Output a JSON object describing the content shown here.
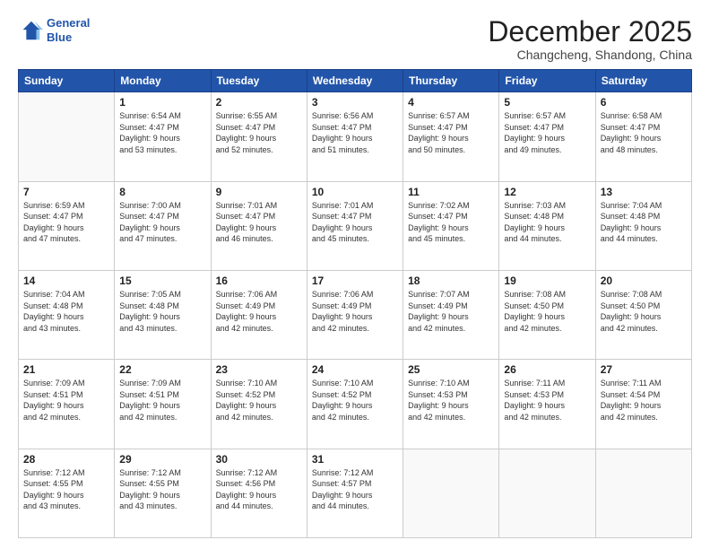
{
  "header": {
    "logo_line1": "General",
    "logo_line2": "Blue",
    "month": "December 2025",
    "location": "Changcheng, Shandong, China"
  },
  "days_of_week": [
    "Sunday",
    "Monday",
    "Tuesday",
    "Wednesday",
    "Thursday",
    "Friday",
    "Saturday"
  ],
  "weeks": [
    [
      {
        "day": "",
        "sunrise": "",
        "sunset": "",
        "daylight": ""
      },
      {
        "day": "1",
        "sunrise": "6:54 AM",
        "sunset": "4:47 PM",
        "daylight": "9 hours and 53 minutes."
      },
      {
        "day": "2",
        "sunrise": "6:55 AM",
        "sunset": "4:47 PM",
        "daylight": "9 hours and 52 minutes."
      },
      {
        "day": "3",
        "sunrise": "6:56 AM",
        "sunset": "4:47 PM",
        "daylight": "9 hours and 51 minutes."
      },
      {
        "day": "4",
        "sunrise": "6:57 AM",
        "sunset": "4:47 PM",
        "daylight": "9 hours and 50 minutes."
      },
      {
        "day": "5",
        "sunrise": "6:57 AM",
        "sunset": "4:47 PM",
        "daylight": "9 hours and 49 minutes."
      },
      {
        "day": "6",
        "sunrise": "6:58 AM",
        "sunset": "4:47 PM",
        "daylight": "9 hours and 48 minutes."
      }
    ],
    [
      {
        "day": "7",
        "sunrise": "6:59 AM",
        "sunset": "4:47 PM",
        "daylight": "9 hours and 47 minutes."
      },
      {
        "day": "8",
        "sunrise": "7:00 AM",
        "sunset": "4:47 PM",
        "daylight": "9 hours and 47 minutes."
      },
      {
        "day": "9",
        "sunrise": "7:01 AM",
        "sunset": "4:47 PM",
        "daylight": "9 hours and 46 minutes."
      },
      {
        "day": "10",
        "sunrise": "7:01 AM",
        "sunset": "4:47 PM",
        "daylight": "9 hours and 45 minutes."
      },
      {
        "day": "11",
        "sunrise": "7:02 AM",
        "sunset": "4:47 PM",
        "daylight": "9 hours and 45 minutes."
      },
      {
        "day": "12",
        "sunrise": "7:03 AM",
        "sunset": "4:48 PM",
        "daylight": "9 hours and 44 minutes."
      },
      {
        "day": "13",
        "sunrise": "7:04 AM",
        "sunset": "4:48 PM",
        "daylight": "9 hours and 44 minutes."
      }
    ],
    [
      {
        "day": "14",
        "sunrise": "7:04 AM",
        "sunset": "4:48 PM",
        "daylight": "9 hours and 43 minutes."
      },
      {
        "day": "15",
        "sunrise": "7:05 AM",
        "sunset": "4:48 PM",
        "daylight": "9 hours and 43 minutes."
      },
      {
        "day": "16",
        "sunrise": "7:06 AM",
        "sunset": "4:49 PM",
        "daylight": "9 hours and 42 minutes."
      },
      {
        "day": "17",
        "sunrise": "7:06 AM",
        "sunset": "4:49 PM",
        "daylight": "9 hours and 42 minutes."
      },
      {
        "day": "18",
        "sunrise": "7:07 AM",
        "sunset": "4:49 PM",
        "daylight": "9 hours and 42 minutes."
      },
      {
        "day": "19",
        "sunrise": "7:08 AM",
        "sunset": "4:50 PM",
        "daylight": "9 hours and 42 minutes."
      },
      {
        "day": "20",
        "sunrise": "7:08 AM",
        "sunset": "4:50 PM",
        "daylight": "9 hours and 42 minutes."
      }
    ],
    [
      {
        "day": "21",
        "sunrise": "7:09 AM",
        "sunset": "4:51 PM",
        "daylight": "9 hours and 42 minutes."
      },
      {
        "day": "22",
        "sunrise": "7:09 AM",
        "sunset": "4:51 PM",
        "daylight": "9 hours and 42 minutes."
      },
      {
        "day": "23",
        "sunrise": "7:10 AM",
        "sunset": "4:52 PM",
        "daylight": "9 hours and 42 minutes."
      },
      {
        "day": "24",
        "sunrise": "7:10 AM",
        "sunset": "4:52 PM",
        "daylight": "9 hours and 42 minutes."
      },
      {
        "day": "25",
        "sunrise": "7:10 AM",
        "sunset": "4:53 PM",
        "daylight": "9 hours and 42 minutes."
      },
      {
        "day": "26",
        "sunrise": "7:11 AM",
        "sunset": "4:53 PM",
        "daylight": "9 hours and 42 minutes."
      },
      {
        "day": "27",
        "sunrise": "7:11 AM",
        "sunset": "4:54 PM",
        "daylight": "9 hours and 42 minutes."
      }
    ],
    [
      {
        "day": "28",
        "sunrise": "7:12 AM",
        "sunset": "4:55 PM",
        "daylight": "9 hours and 43 minutes."
      },
      {
        "day": "29",
        "sunrise": "7:12 AM",
        "sunset": "4:55 PM",
        "daylight": "9 hours and 43 minutes."
      },
      {
        "day": "30",
        "sunrise": "7:12 AM",
        "sunset": "4:56 PM",
        "daylight": "9 hours and 44 minutes."
      },
      {
        "day": "31",
        "sunrise": "7:12 AM",
        "sunset": "4:57 PM",
        "daylight": "9 hours and 44 minutes."
      },
      {
        "day": "",
        "sunrise": "",
        "sunset": "",
        "daylight": ""
      },
      {
        "day": "",
        "sunrise": "",
        "sunset": "",
        "daylight": ""
      },
      {
        "day": "",
        "sunrise": "",
        "sunset": "",
        "daylight": ""
      }
    ]
  ]
}
